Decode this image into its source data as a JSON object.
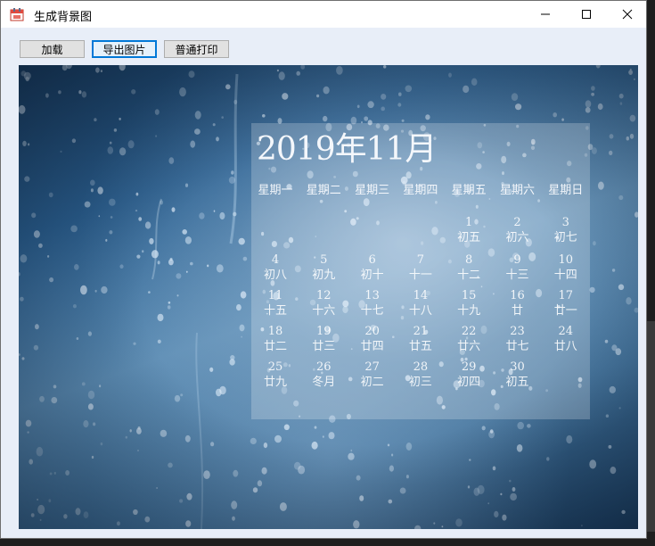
{
  "window": {
    "title": "生成背景图"
  },
  "toolbar": {
    "load_label": "加载",
    "export_label": "导出图片",
    "print_label": "普通打印"
  },
  "calendar": {
    "title": "2019年11月",
    "weekdays": [
      "星期一",
      "星期二",
      "星期三",
      "星期四",
      "星期五",
      "星期六",
      "星期日"
    ],
    "days": [
      {
        "num": "1",
        "lunar": "初五"
      },
      {
        "num": "2",
        "lunar": "初六"
      },
      {
        "num": "3",
        "lunar": "初七"
      },
      {
        "num": "4",
        "lunar": "初八"
      },
      {
        "num": "5",
        "lunar": "初九"
      },
      {
        "num": "6",
        "lunar": "初十"
      },
      {
        "num": "7",
        "lunar": "十一"
      },
      {
        "num": "8",
        "lunar": "十二"
      },
      {
        "num": "9",
        "lunar": "十三"
      },
      {
        "num": "10",
        "lunar": "十四"
      },
      {
        "num": "11",
        "lunar": "十五"
      },
      {
        "num": "12",
        "lunar": "十六"
      },
      {
        "num": "13",
        "lunar": "十七"
      },
      {
        "num": "14",
        "lunar": "十八"
      },
      {
        "num": "15",
        "lunar": "十九"
      },
      {
        "num": "16",
        "lunar": "廿"
      },
      {
        "num": "17",
        "lunar": "廿一"
      },
      {
        "num": "18",
        "lunar": "廿二"
      },
      {
        "num": "19",
        "lunar": "廿三"
      },
      {
        "num": "20",
        "lunar": "廿四"
      },
      {
        "num": "21",
        "lunar": "廿五"
      },
      {
        "num": "22",
        "lunar": "廿六"
      },
      {
        "num": "23",
        "lunar": "廿七"
      },
      {
        "num": "24",
        "lunar": "廿八"
      },
      {
        "num": "25",
        "lunar": "廿九"
      },
      {
        "num": "26",
        "lunar": "冬月"
      },
      {
        "num": "27",
        "lunar": "初二"
      },
      {
        "num": "28",
        "lunar": "初三"
      },
      {
        "num": "29",
        "lunar": "初四"
      },
      {
        "num": "30",
        "lunar": "初五"
      }
    ]
  },
  "icons": {
    "app": "calendar-icon",
    "minimize": "minimize-icon",
    "maximize": "maximize-icon",
    "close": "close-icon"
  },
  "colors": {
    "accent": "#0078d7",
    "client_background": "#e8eef8"
  }
}
